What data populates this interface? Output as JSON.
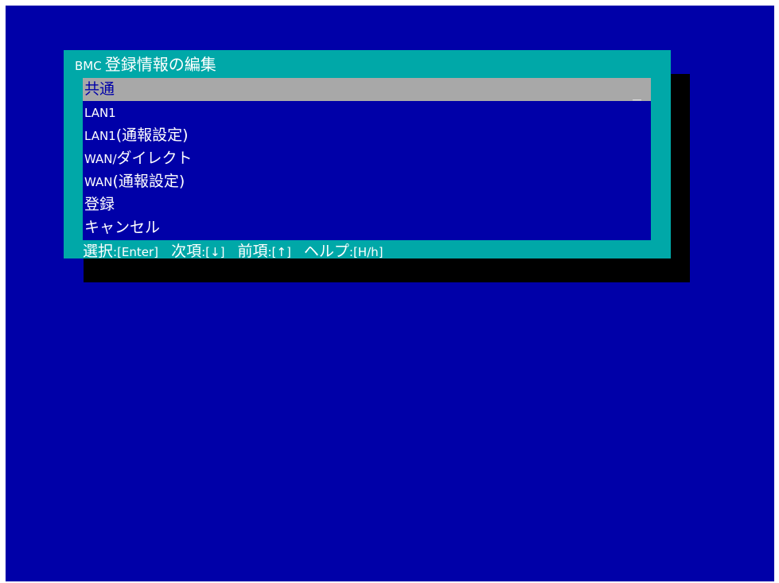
{
  "dialog": {
    "title_prefix": "BMC",
    "title": "登録情報の編集"
  },
  "menu": {
    "items": [
      {
        "main": "共通",
        "suffix": ""
      },
      {
        "main": "LAN1",
        "suffix": ""
      },
      {
        "main": "LAN1",
        "suffix": "(通報設定)"
      },
      {
        "main": "WAN/",
        "suffix": "ダイレクト"
      },
      {
        "main": "WAN",
        "suffix": "(通報設定)"
      },
      {
        "main": "登録",
        "suffix": ""
      },
      {
        "main": "キャンセル",
        "suffix": ""
      }
    ],
    "selected_index": 0,
    "cursor": "_"
  },
  "status": {
    "select_label": "選択",
    "select_key": ":[Enter]",
    "next_label": "次項",
    "next_key": ":[↓]",
    "prev_label": "前項",
    "prev_key": ":[↑]",
    "help_label": "ヘルプ",
    "help_key": ":[H/h]"
  },
  "colors": {
    "screen_bg": "#0000a8",
    "dialog_bg": "#00a8a8",
    "highlight_bg": "#a8a8a8",
    "shadow": "#000000",
    "text": "#ffffff"
  }
}
